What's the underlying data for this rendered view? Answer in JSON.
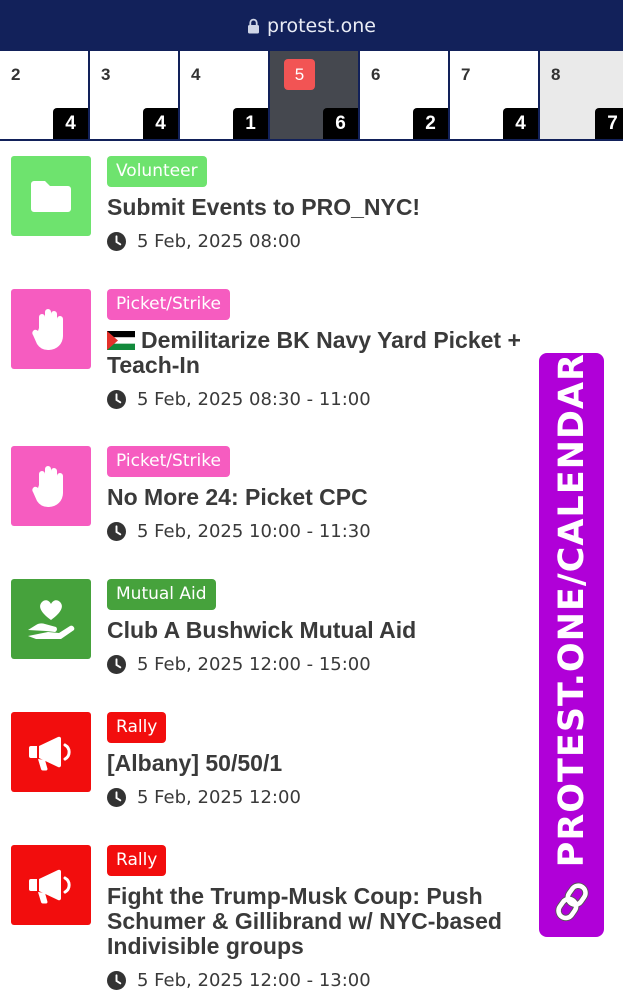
{
  "browser": {
    "url": "protest.one"
  },
  "calendar": {
    "days": [
      {
        "day": "2",
        "count": "4"
      },
      {
        "day": "3",
        "count": "4"
      },
      {
        "day": "4",
        "count": "1"
      },
      {
        "day": "5",
        "count": "6",
        "today": true
      },
      {
        "day": "6",
        "count": "2"
      },
      {
        "day": "7",
        "count": "4"
      },
      {
        "day": "8",
        "count": "7",
        "muted": true
      }
    ]
  },
  "events": [
    {
      "category": "Volunteer",
      "category_color": "#6ee36e",
      "icon": "folder-icon",
      "flag": false,
      "title": "Submit Events to PRO_NYC!",
      "time": "5 Feb, 2025 08:00"
    },
    {
      "category": "Picket/Strike",
      "category_color": "#f65cc0",
      "icon": "hand-icon",
      "flag": true,
      "title": "Demilitarize BK Navy Yard Picket + Teach-In",
      "time": "5 Feb, 2025 08:30 - 11:00"
    },
    {
      "category": "Picket/Strike",
      "category_color": "#f65cc0",
      "icon": "hand-icon",
      "flag": false,
      "title": "No More 24: Picket CPC",
      "time": "5 Feb, 2025 10:00 - 11:30"
    },
    {
      "category": "Mutual Aid",
      "category_color": "#46a23c",
      "icon": "heart-hand-icon",
      "flag": false,
      "title": "Club A Bushwick Mutual Aid",
      "time": "5 Feb, 2025 12:00 - 15:00"
    },
    {
      "category": "Rally",
      "category_color": "#f20d0d",
      "icon": "megaphone-icon",
      "flag": false,
      "title": "[Albany] 50/50/1",
      "time": "5 Feb, 2025 12:00"
    },
    {
      "category": "Rally",
      "category_color": "#f20d0d",
      "icon": "megaphone-icon",
      "flag": false,
      "title": "Fight the Trump-Musk Coup: Push Schumer & Gillibrand w/ NYC-based Indivisible groups",
      "time": "5 Feb, 2025 12:00 - 13:00"
    }
  ],
  "banner": {
    "text": "PROTEST.ONE/CALENDAR",
    "color": "#b000d8",
    "icon": "link-icon"
  }
}
